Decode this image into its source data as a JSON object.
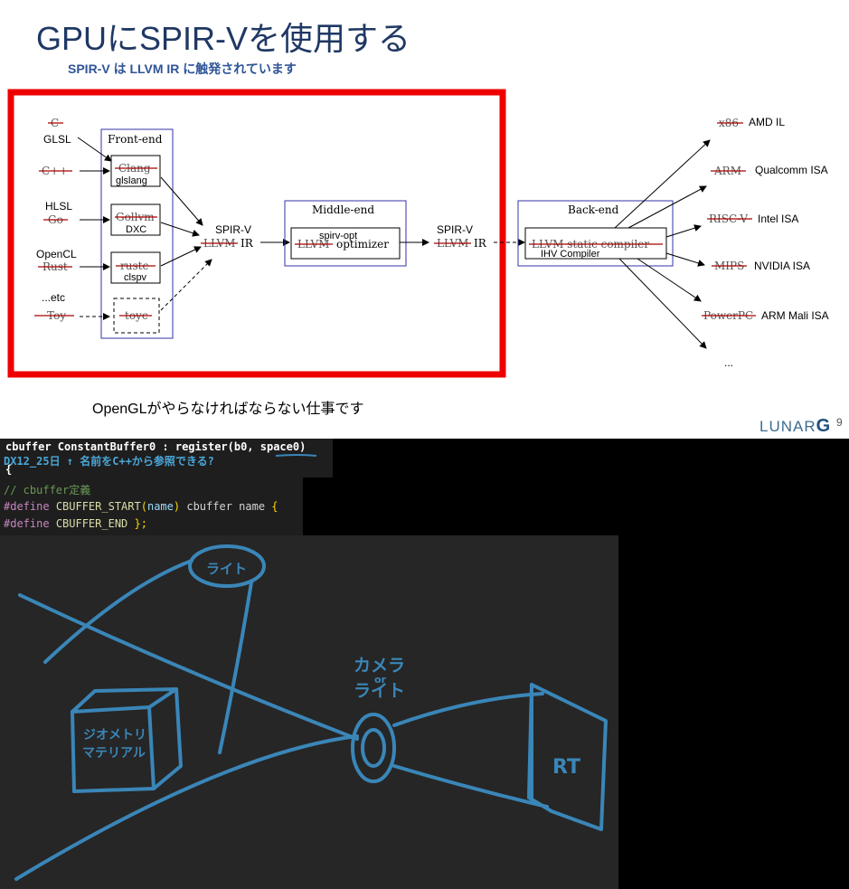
{
  "slide": {
    "title": "GPUにSPIR-Vを使用する",
    "subtitle": "SPIR-V は LLVM IR に触発されています",
    "caption": "OpenGLがやらなければならない仕事です",
    "logo": "LUNAR",
    "logo_g": "G",
    "page_number": "9"
  },
  "diagram": {
    "frontend_label": "Front-end",
    "middleend_label": "Middle-end",
    "backend_label": "Back-end",
    "inputs": [
      {
        "struck": "C",
        "new": "GLSL"
      },
      {
        "struck": "C++",
        "new": ""
      },
      {
        "struck": "Go",
        "new": "HLSL"
      },
      {
        "struck": "Rust",
        "new": "OpenCL"
      },
      {
        "struck": "Toy",
        "new": "...etc"
      }
    ],
    "frontends": [
      {
        "struck": "Clang",
        "new": "glslang"
      },
      {
        "struck": "Gollvm",
        "new": "DXC"
      },
      {
        "struck": "rustc",
        "new": "clspv"
      },
      {
        "struck": "toyc",
        "new": ""
      }
    ],
    "ir1_top": "SPIR-V",
    "ir1_struck": "LLVM",
    "ir1_suffix": "IR",
    "optimizer_new": "spirv-opt",
    "optimizer_struck": "LLVM",
    "optimizer_suffix": "optimizer",
    "ir2_top": "SPIR-V",
    "ir2_struck": "LLVM",
    "ir2_suffix": "IR",
    "backend_struck": "LLVM static compiler",
    "backend_new": "IHV Compiler",
    "targets": [
      {
        "struck": "x86",
        "new": "AMD IL"
      },
      {
        "struck": "ARM",
        "new": "Qualcomm ISA"
      },
      {
        "struck": "RISC-V",
        "new": "Intel ISA"
      },
      {
        "struck": "MIPS",
        "new": "NVIDIA ISA"
      },
      {
        "struck": "PowerPC",
        "new": "ARM Mali ISA"
      },
      {
        "struck": "",
        "new": "..."
      }
    ]
  },
  "code_top": {
    "line": "cbuffer ConstantBuffer0 : register(b0, space0)",
    "note": "DX12_25日 ↑ 名前をC++から参照できる?",
    "brace": "{"
  },
  "code_mid": {
    "comment": "// cbuffer定義",
    "define1_kw": "#define",
    "define1_name": "CBUFFER_START",
    "define1_paren_open": "(",
    "define1_arg": "name",
    "define1_paren_close": ")",
    "define1_body": "cbuffer name",
    "define1_brace": "{",
    "define2_kw": "#define",
    "define2_name": "CBUFFER_END",
    "define2_body": "};"
  },
  "sketch": {
    "light_label": "ライト",
    "camera_label": "カメラ",
    "or_label": "or",
    "light2_label": "ライト",
    "geometry_label1": "ジオメトリ",
    "geometry_label2": "マテリアル",
    "rt_label": "RT"
  },
  "colors": {
    "title": "#1f3864",
    "red_frame": "#ee0000",
    "box_border": "#3333aa",
    "handwriting": "#3a86b8"
  }
}
